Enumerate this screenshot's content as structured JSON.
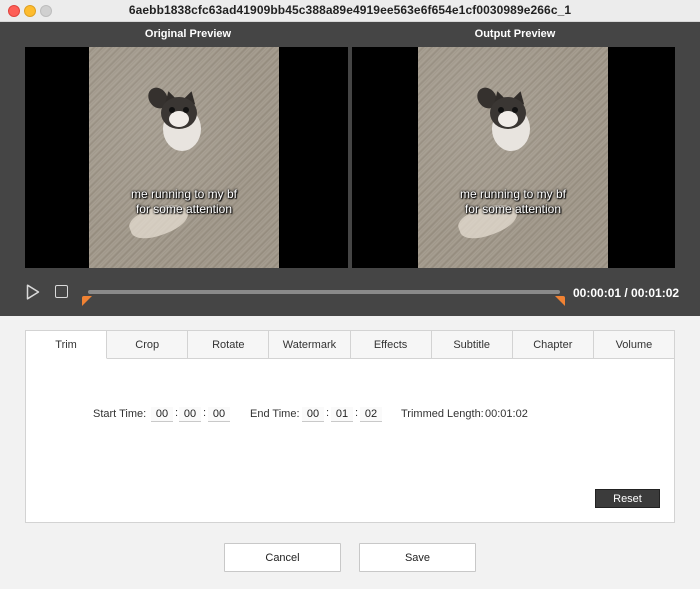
{
  "window": {
    "title": "6aebb1838cfc63ad41909bb45c388a89e4919ee563e6f654e1cf0030989e266c_1"
  },
  "preview": {
    "original_label": "Original Preview",
    "output_label": "Output  Preview",
    "caption_line1": "me running to my bf",
    "caption_line2": "for some attention"
  },
  "playback": {
    "time_readout": "00:00:01 / 00:01:02",
    "progress_fraction": 0.0,
    "accent_color": "#f08233"
  },
  "tabs": [
    {
      "label": "Trim",
      "active": true
    },
    {
      "label": "Crop"
    },
    {
      "label": "Rotate"
    },
    {
      "label": "Watermark"
    },
    {
      "label": "Effects"
    },
    {
      "label": "Subtitle"
    },
    {
      "label": "Chapter"
    },
    {
      "label": "Volume"
    }
  ],
  "trim": {
    "start_label": "Start Time:",
    "start": [
      "00",
      "00",
      "00"
    ],
    "end_label": "End Time:",
    "end": [
      "00",
      "01",
      "02"
    ],
    "length_label": "Trimmed Length:",
    "length_value": "00:01:02",
    "separator": ":"
  },
  "buttons": {
    "reset": "Reset",
    "cancel": "Cancel",
    "save": "Save"
  }
}
